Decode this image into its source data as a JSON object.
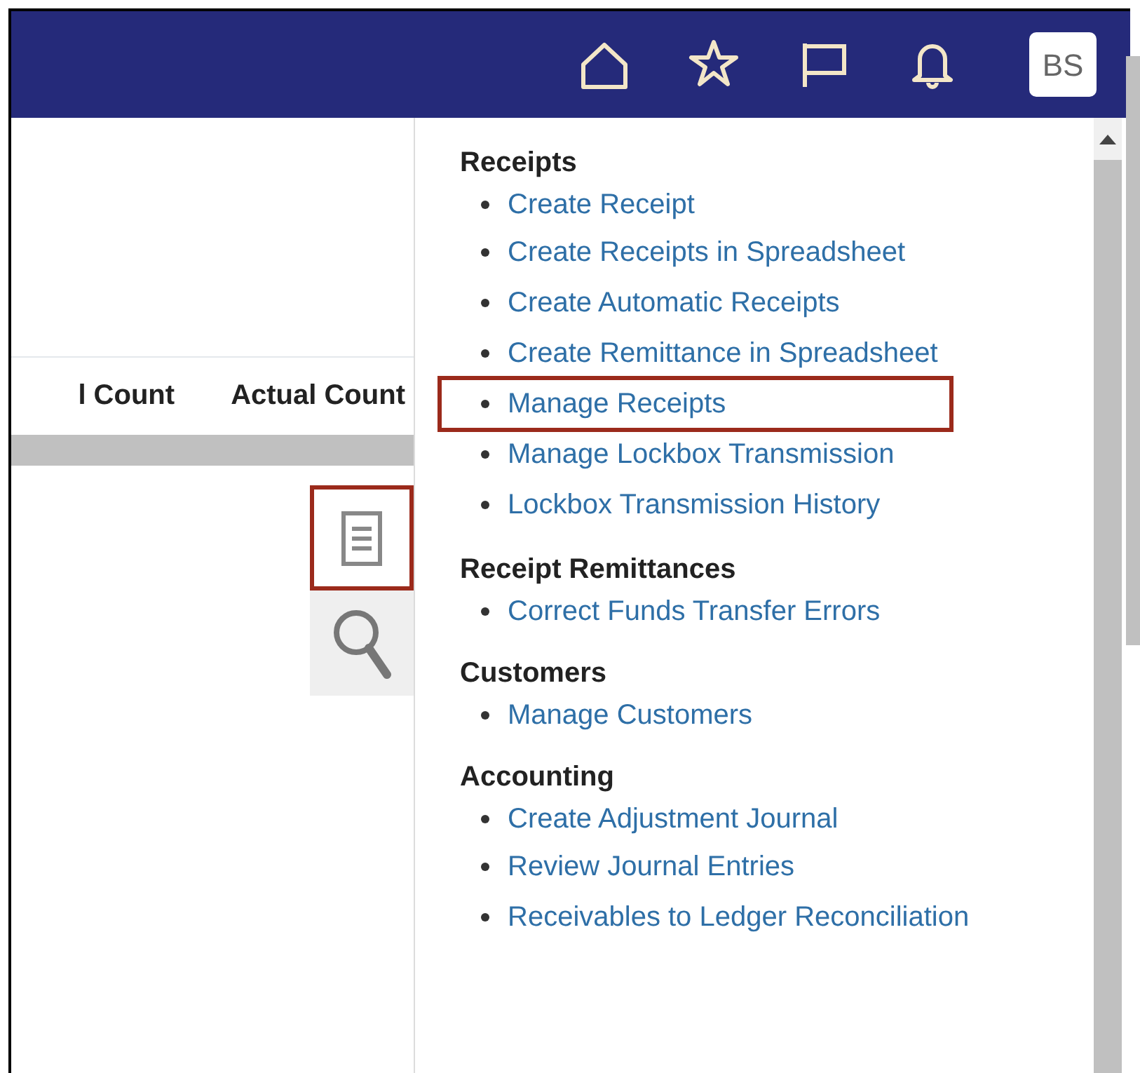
{
  "header": {
    "icons": [
      {
        "kind": "home"
      },
      {
        "kind": "star"
      },
      {
        "kind": "flag"
      },
      {
        "kind": "bell"
      }
    ],
    "avatar": "BS"
  },
  "table": {
    "columns": [
      "l Count",
      "Actual Count"
    ]
  },
  "tools": [
    {
      "kind": "details",
      "highlighted": true
    },
    {
      "kind": "search",
      "highlighted": false
    }
  ],
  "menu": [
    {
      "title": "Receipts",
      "items": [
        {
          "label": "Create Receipt",
          "highlighted": false
        },
        {
          "label": "Create Receipts in Spreadsheet",
          "highlighted": false
        },
        {
          "label": "Create Automatic Receipts",
          "highlighted": false
        },
        {
          "label": "Create Remittance in Spreadsheet",
          "highlighted": false
        },
        {
          "label": "Manage Receipts",
          "highlighted": true
        },
        {
          "label": "Manage Lockbox Transmission",
          "highlighted": false
        },
        {
          "label": "Lockbox Transmission History",
          "highlighted": false
        }
      ]
    },
    {
      "title": "Receipt Remittances",
      "items": [
        {
          "label": "Correct Funds Transfer Errors",
          "highlighted": false
        }
      ]
    },
    {
      "title": "Customers",
      "items": [
        {
          "label": "Manage Customers",
          "highlighted": false
        }
      ]
    },
    {
      "title": "Accounting",
      "items": [
        {
          "label": "Create Adjustment Journal",
          "highlighted": false
        },
        {
          "label": "Review Journal Entries",
          "highlighted": false
        },
        {
          "label": "Receivables to Ledger Reconciliation",
          "highlighted": false
        }
      ]
    }
  ]
}
